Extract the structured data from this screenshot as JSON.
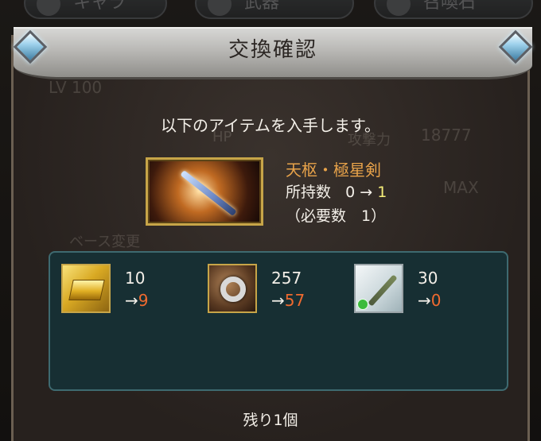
{
  "background_tabs": [
    {
      "label": "キャラ"
    },
    {
      "label": "武器"
    },
    {
      "label": "召喚石"
    }
  ],
  "background_ghost": {
    "level": "LV 100",
    "hp_label": "HP",
    "atk_label": "攻撃力",
    "atk_value": "18777",
    "max_label": "MAX",
    "base_change": "ベース変更"
  },
  "dialog": {
    "title": "交換確認",
    "message": "以下のアイテムを入手します。",
    "item": {
      "name": "天枢・極星剣",
      "own_label": "所持数",
      "own_before": "0",
      "arrow": "→",
      "own_after": "1",
      "required_text": "（必要数　1）"
    },
    "materials": [
      {
        "icon": "gold-bar-icon",
        "before": "10",
        "after": "9"
      },
      {
        "icon": "silver-ring-icon",
        "before": "257",
        "after": "57"
      },
      {
        "icon": "green-blade-icon",
        "before": "30",
        "after": "0"
      }
    ],
    "remaining": "残り1個"
  },
  "colors": {
    "item_name": "#e8a34a",
    "new_count": "#f7f07a",
    "after_value": "#ef6a2f",
    "panel_bg": "#172f33",
    "panel_border": "#3e6a70"
  }
}
